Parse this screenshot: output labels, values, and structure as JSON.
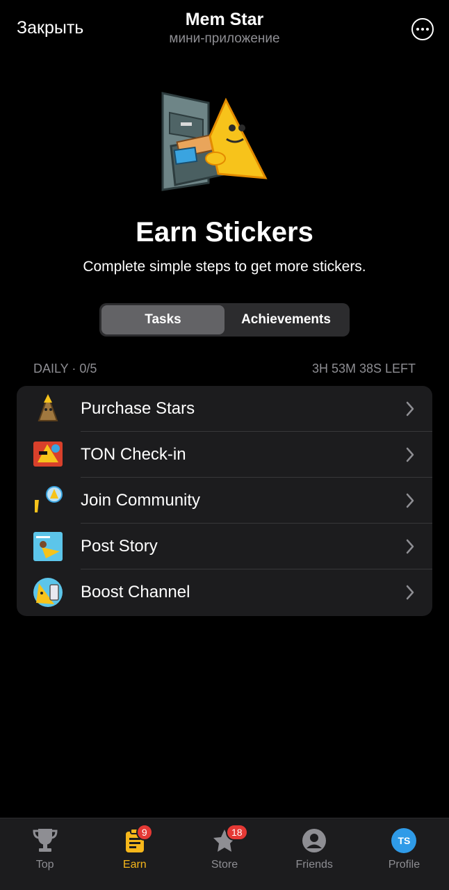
{
  "header": {
    "close_label": "Закрыть",
    "title": "Mem Star",
    "subtitle": "мини-приложение",
    "more_icon": "more-horizontal-circle-icon"
  },
  "hero": {
    "title": "Earn Stickers",
    "subtitle": "Complete simple steps to get more stickers."
  },
  "segmented": {
    "tabs": [
      {
        "label": "Tasks",
        "active": true
      },
      {
        "label": "Achievements",
        "active": false
      }
    ]
  },
  "daily": {
    "label": "DAILY · 0/5",
    "time_left": "3H 53M 38S LEFT"
  },
  "tasks": [
    {
      "label": "Purchase Stars",
      "icon": "stars-sticker-icon"
    },
    {
      "label": "TON Check-in",
      "icon": "ton-sticker-icon"
    },
    {
      "label": "Join Community",
      "icon": "community-sticker-icon"
    },
    {
      "label": "Post Story",
      "icon": "story-sticker-icon"
    },
    {
      "label": "Boost Channel",
      "icon": "boost-sticker-icon"
    }
  ],
  "tabbar": {
    "items": [
      {
        "label": "Top",
        "icon": "trophy-icon",
        "active": false,
        "badge": ""
      },
      {
        "label": "Earn",
        "icon": "clipboard-icon",
        "active": true,
        "badge": "9"
      },
      {
        "label": "Store",
        "icon": "star-icon",
        "active": false,
        "badge": "18"
      },
      {
        "label": "Friends",
        "icon": "person-icon",
        "active": false,
        "badge": ""
      },
      {
        "label": "Profile",
        "icon": "avatar-icon",
        "active": false,
        "badge": "",
        "avatar_initials": "TS"
      }
    ]
  },
  "colors": {
    "accent": "#f6b71b",
    "badge": "#e53935",
    "avatar": "#2f9be8",
    "card": "#1c1c1e"
  }
}
